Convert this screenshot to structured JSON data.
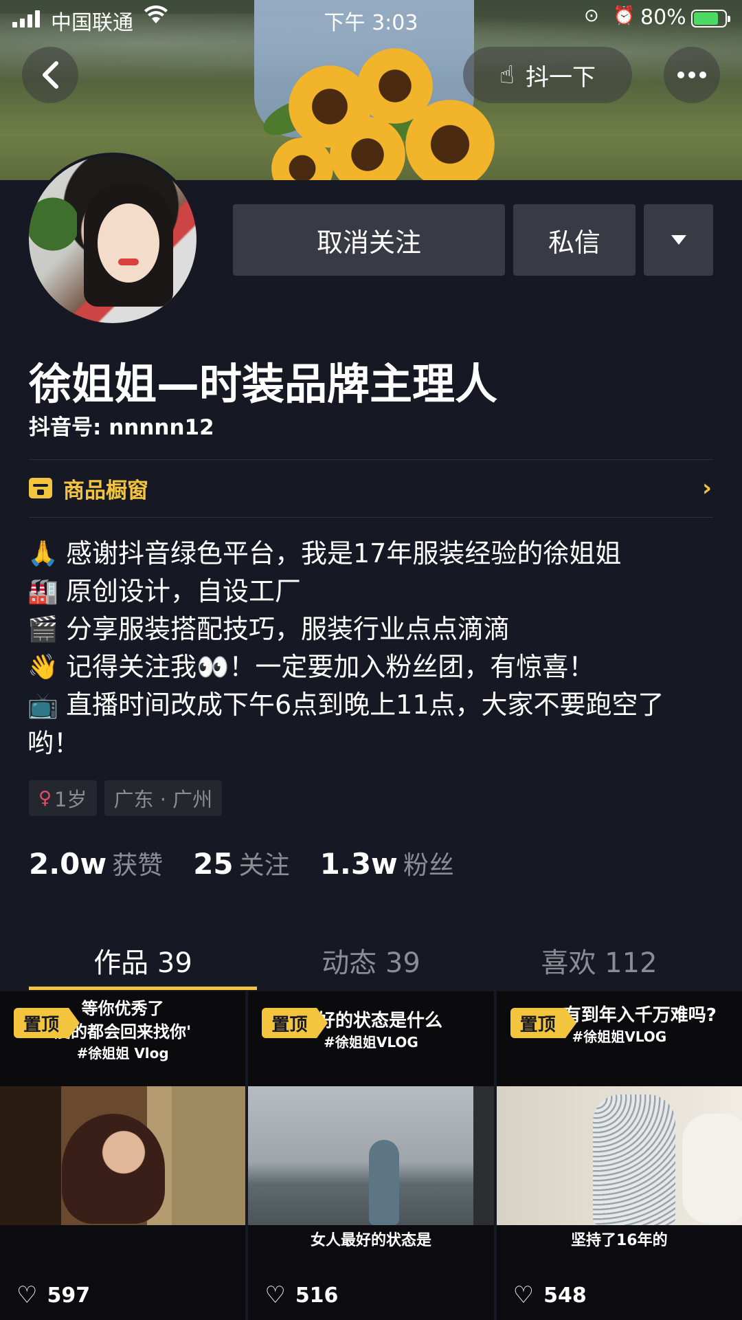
{
  "status_bar": {
    "carrier": "中国联通",
    "time": "下午 3:03",
    "battery": "80%",
    "battery_level": 0.8
  },
  "nav": {
    "shake_label": "抖一下"
  },
  "actions": {
    "unfollow": "取消关注",
    "message": "私信"
  },
  "profile": {
    "name": "徐姐姐—时装品牌主理人",
    "douyin_id": "抖音号: nnnnn12",
    "shop_label": "商品橱窗",
    "bio": [
      {
        "emoji": "🙏",
        "text": "感谢抖音绿色平台，我是17年服装经验的徐姐姐"
      },
      {
        "emoji": "🏭",
        "text": "原创设计，自设工厂"
      },
      {
        "emoji": "🎬",
        "text": "分享服装搭配技巧，服装行业点点滴滴"
      },
      {
        "emoji": "👋",
        "text": "记得关注我👀！一定要加入粉丝团，有惊喜！"
      },
      {
        "emoji": "📺",
        "text": "直播时间改成下午6点到晚上11点，大家不要跑空了哟！"
      }
    ],
    "tags": {
      "age": "1岁",
      "location": "广东 · 广州"
    },
    "stats": [
      {
        "num": "2.0w",
        "label": "获赞"
      },
      {
        "num": "25",
        "label": "关注"
      },
      {
        "num": "1.3w",
        "label": "粉丝"
      }
    ]
  },
  "tabs": [
    {
      "label": "作品 39",
      "active": true
    },
    {
      "label": "动态 39",
      "active": false
    },
    {
      "label": "喜欢 112",
      "active": false
    }
  ],
  "videos": [
    {
      "pin": "置顶",
      "top_caption": "等你优秀了",
      "top_caption2": "爱的都会回来找你'",
      "top_caption3": "#徐姐姐 Vlog",
      "bottom_caption": "",
      "likes": "597"
    },
    {
      "pin": "置顶",
      "top_caption": "最好的状态是什么",
      "top_caption2": "#徐姐姐VLOG",
      "top_caption3": "",
      "bottom_caption": "女人最好的状态是",
      "likes": "516"
    },
    {
      "pin": "置顶",
      "top_caption": "有到年入千万难吗?",
      "top_caption2": "#徐姐姐VLOG",
      "top_caption3": "",
      "bottom_caption": "坚持了16年的",
      "likes": "548"
    }
  ]
}
